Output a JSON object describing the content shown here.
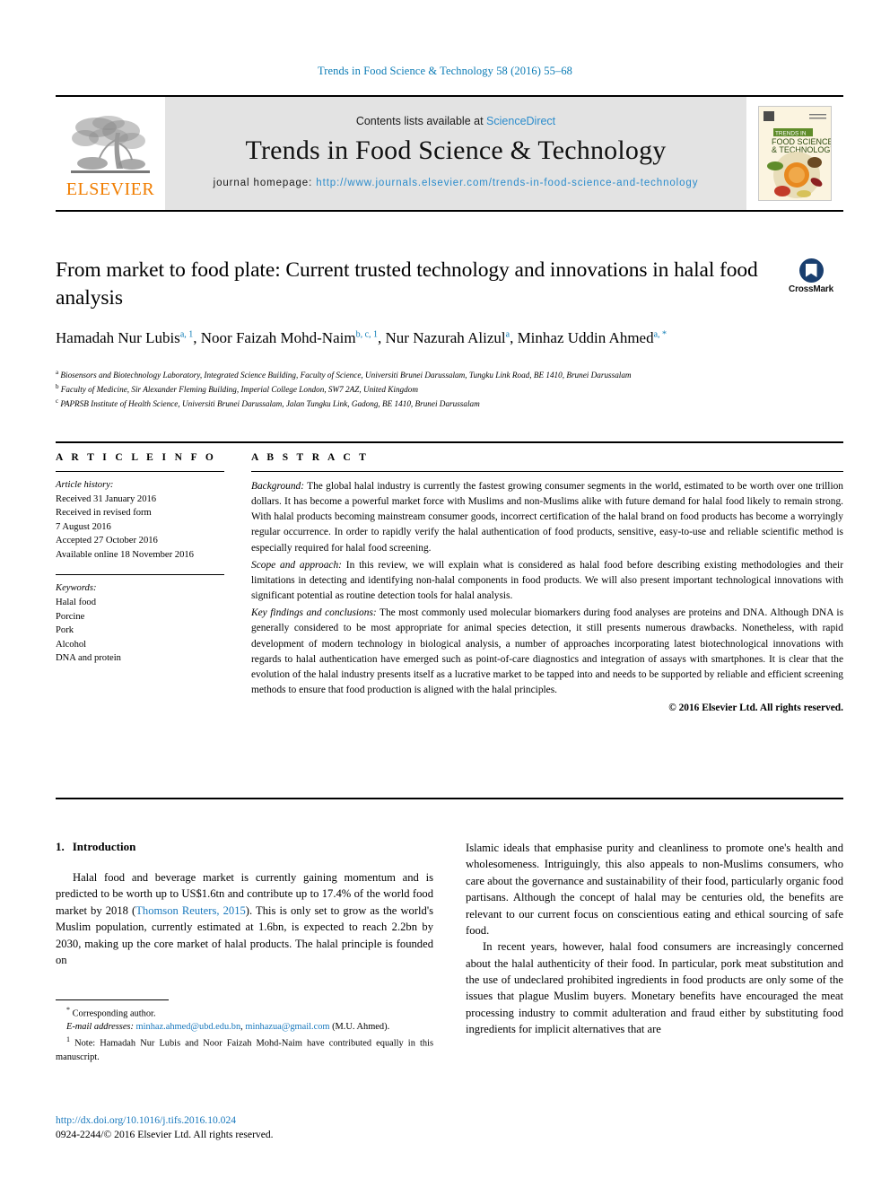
{
  "running_head": "Trends in Food Science & Technology 58 (2016) 55–68",
  "masthead": {
    "publisher_name": "ELSEVIER",
    "contents_prefix": "Contents lists available at",
    "contents_link": "ScienceDirect",
    "journal_title": "Trends in Food Science & Technology",
    "homepage_label": "journal homepage:",
    "homepage_url": "http://www.journals.elsevier.com/trends-in-food-science-and-technology",
    "cover_line1": "TRENDS IN",
    "cover_line2": "FOOD SCIENCE",
    "cover_line3": "& TECHNOLOGY"
  },
  "article": {
    "title": "From market to food plate: Current trusted technology and innovations in halal food analysis",
    "authors": [
      {
        "name": "Hamadah Nur Lubis",
        "marks": "a, 1",
        "sep": ", "
      },
      {
        "name": "Noor Faizah Mohd-Naim",
        "marks": "b, c, 1",
        "sep": ", "
      },
      {
        "name": "Nur Nazurah Alizul",
        "marks": "a",
        "sep": ", "
      },
      {
        "name": "Minhaz Uddin Ahmed",
        "marks": "a, *",
        "sep": ""
      }
    ],
    "crossmark_label": "CrossMark",
    "affiliations": [
      {
        "mark": "a",
        "text": "Biosensors and Biotechnology Laboratory, Integrated Science Building, Faculty of Science, Universiti Brunei Darussalam, Tungku Link Road, BE 1410, Brunei Darussalam"
      },
      {
        "mark": "b",
        "text": "Faculty of Medicine, Sir Alexander Fleming Building, Imperial College London, SW7 2AZ, United Kingdom"
      },
      {
        "mark": "c",
        "text": "PAPRSB Institute of Health Science, Universiti Brunei Darussalam, Jalan Tungku Link, Gadong, BE 1410, Brunei Darussalam"
      }
    ]
  },
  "article_info": {
    "heading": "A R T I C L E   I N F O",
    "history_label": "Article history:",
    "history": [
      "Received 31 January 2016",
      "Received in revised form",
      "7 August 2016",
      "Accepted 27 October 2016",
      "Available online 18 November 2016"
    ],
    "keywords_label": "Keywords:",
    "keywords": [
      "Halal food",
      "Porcine",
      "Pork",
      "Alcohol",
      "DNA and protein"
    ]
  },
  "abstract": {
    "heading": "A B S T R A C T",
    "paragraphs": [
      {
        "run_in": "Background:",
        "text": " The global halal industry is currently the fastest growing consumer segments in the world, estimated to be worth over one trillion dollars. It has become a powerful market force with Muslims and non-Muslims alike with future demand for halal food likely to remain strong. With halal products becoming mainstream consumer goods, incorrect certification of the halal brand on food products has become a worryingly regular occurrence. In order to rapidly verify the halal authentication of food products, sensitive, easy-to-use and reliable scientific method is especially required for halal food screening."
      },
      {
        "run_in": "Scope and approach:",
        "text": " In this review, we will explain what is considered as halal food before describing existing methodologies and their limitations in detecting and identifying non-halal components in food products. We will also present important technological innovations with significant potential as routine detection tools for halal analysis."
      },
      {
        "run_in": "Key findings and conclusions:",
        "text": " The most commonly used molecular biomarkers during food analyses are proteins and DNA. Although DNA is generally considered to be most appropriate for animal species detection, it still presents numerous drawbacks. Nonetheless, with rapid development of modern technology in biological analysis, a number of approaches incorporating latest biotechnological innovations with regards to halal authentication have emerged such as point-of-care diagnostics and integration of assays with smartphones. It is clear that the evolution of the halal industry presents itself as a lucrative market to be tapped into and needs to be supported by reliable and efficient screening methods to ensure that food production is aligned with the halal principles."
      }
    ],
    "copyright": "© 2016 Elsevier Ltd. All rights reserved."
  },
  "body": {
    "section_number": "1.",
    "section_title": "Introduction",
    "left_paragraphs": [
      {
        "before": "Halal food and beverage market is currently gaining momentum and is predicted to be worth up to US$1.6tn and contribute up to 17.4% of the world food market by 2018 (",
        "cite": "Thomson Reuters, 2015",
        "after": "). This is only set to grow as the world's Muslim population, currently estimated at 1.6bn, is expected to reach 2.2bn by 2030, making up the core market of halal products. The halal principle is founded on"
      }
    ],
    "right_paragraphs": [
      "Islamic ideals that emphasise purity and cleanliness to promote one's health and wholesomeness. Intriguingly, this also appeals to non-Muslims consumers, who care about the governance and sustainability of their food, particularly organic food partisans. Although the concept of halal may be centuries old, the benefits are relevant to our current focus on conscientious eating and ethical sourcing of safe food.",
      "In recent years, however, halal food consumers are increasingly concerned about the halal authenticity of their food. In particular, pork meat substitution and the use of undeclared prohibited ingredients in food products are only some of the issues that plague Muslim buyers. Monetary benefits have encouraged the meat processing industry to commit adulteration and fraud either by substituting food ingredients for implicit alternatives that are"
    ]
  },
  "footnotes": {
    "corresponding_marker": "*",
    "corresponding_text": "Corresponding author.",
    "email_label": "E-mail addresses:",
    "email1": "minhaz.ahmed@ubd.edu.bn",
    "email_sep": ", ",
    "email2": "minhazua@gmail.com",
    "email_attrib": "(M.U. Ahmed).",
    "note_marker": "1",
    "note_text": "Note: Hamadah Nur Lubis and Noor Faizah Mohd-Naim have contributed equally in this manuscript."
  },
  "footer": {
    "doi": "http://dx.doi.org/10.1016/j.tifs.2016.10.024",
    "issn_line": "0924-2244/© 2016 Elsevier Ltd. All rights reserved."
  },
  "colors": {
    "link_blue": "#1878bd",
    "running_head_blue": "#0b7bb5",
    "elsevier_orange": "#f07d00",
    "masthead_grey": "#e3e3e3"
  }
}
